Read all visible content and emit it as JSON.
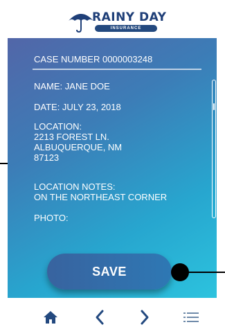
{
  "app": {
    "logo": {
      "title": "RAINY DAY",
      "subtitle": "INSURANCE"
    }
  },
  "case": {
    "label": "CASE NUMBER 0000003248",
    "name": "NAME:  JANE DOE",
    "date": "DATE: JULY 23, 2018",
    "location": "LOCATION:\n2213 FOREST LN.\nALBUQUERQUE, NM\n87123",
    "location_notes": "LOCATION NOTES:\nON THE NORTHEAST CORNER",
    "photo": "PHOTO:"
  },
  "actions": {
    "save_label": "SAVE"
  },
  "nav": {
    "icons": [
      "home-icon",
      "chevron-left-icon",
      "chevron-right-icon",
      "menu-list-icon"
    ]
  },
  "colors": {
    "brand_navy": "#1f3f78",
    "gradient_start": "#5266a8",
    "gradient_end": "#2cc3de",
    "nav_icon": "#23497f",
    "menu_icon": "#6f8aa9"
  }
}
